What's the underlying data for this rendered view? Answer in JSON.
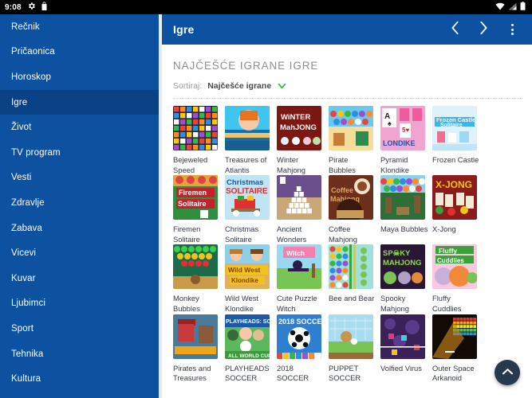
{
  "statusbar": {
    "time": "9:08",
    "icons_left": [
      "gear-icon",
      "shopping-bag-icon"
    ],
    "icons_right": [
      "wifi-icon",
      "signal-icon",
      "battery-icon"
    ]
  },
  "sidebar": {
    "background_color": "#0d52a0",
    "active_color": "#0a4184",
    "items": [
      {
        "label": "Rečnik",
        "active": false
      },
      {
        "label": "Pričaonica",
        "active": false
      },
      {
        "label": "Horoskop",
        "active": false
      },
      {
        "label": "Igre",
        "active": true
      },
      {
        "label": "Život",
        "active": false
      },
      {
        "label": "TV program",
        "active": false
      },
      {
        "label": "Vesti",
        "active": false
      },
      {
        "label": "Zdravlje",
        "active": false
      },
      {
        "label": "Zabava",
        "active": false
      },
      {
        "label": "Vicevi",
        "active": false
      },
      {
        "label": "Kuvar",
        "active": false
      },
      {
        "label": "Ljubimci",
        "active": false
      },
      {
        "label": "Sport",
        "active": false
      },
      {
        "label": "Tehnika",
        "active": false
      },
      {
        "label": "Kultura",
        "active": false
      }
    ]
  },
  "appbar": {
    "title": "Igre",
    "back_icon": "chevron-left-icon",
    "forward_icon": "chevron-right-icon",
    "overflow_icon": "more-vertical-icon"
  },
  "main": {
    "section_title": "NAJČEŠĆE IGRANE IGRE",
    "sort_label": "Sortiraj:",
    "sort_value": "Najčešće igrane",
    "sort_caret_icon": "chevron-down-icon",
    "sort_caret_color": "#39b54a",
    "games": [
      {
        "title": "Bejeweled Speed",
        "thumb": "bejeweled"
      },
      {
        "title": "Treasures of Atlantis",
        "thumb": "atlantis"
      },
      {
        "title": "Winter Mahjong",
        "thumb": "winter-mahjong"
      },
      {
        "title": "Pirate Bubbles",
        "thumb": "pirate-bubbles"
      },
      {
        "title": "Pyramid Klondike",
        "thumb": "pyramid-klondike"
      },
      {
        "title": "Frozen Castle",
        "thumb": "frozen-castle"
      },
      {
        "title": "Firemen Solitaire",
        "thumb": "firemen-solitaire"
      },
      {
        "title": "Christmas Solitaire",
        "thumb": "christmas-solitaire"
      },
      {
        "title": "Ancient Wonders",
        "thumb": "ancient-wonders"
      },
      {
        "title": "Coffee Mahjong",
        "thumb": "coffee-mahjong"
      },
      {
        "title": "Maya Bubbles",
        "thumb": "maya-bubbles"
      },
      {
        "title": "X-Jong",
        "thumb": "x-jong"
      },
      {
        "title": "Monkey Bubbles",
        "thumb": "monkey-bubbles"
      },
      {
        "title": "Wild West Klondike",
        "thumb": "wild-west"
      },
      {
        "title": "Cute Puzzle Witch",
        "thumb": "cute-witch"
      },
      {
        "title": "Bee and Bear",
        "thumb": "bee-bear"
      },
      {
        "title": "Spooky Mahjong",
        "thumb": "spooky-mahjong"
      },
      {
        "title": "Fluffy Cuddlies",
        "thumb": "fluffy-cuddlies"
      },
      {
        "title": "Pirates and Treasures",
        "thumb": "pirates-treasures"
      },
      {
        "title": "PLAYHEADS SOCCER",
        "thumb": "playheads-soccer"
      },
      {
        "title": "2018 SOCCER",
        "thumb": "soccer-2018"
      },
      {
        "title": "PUPPET SOCCER",
        "thumb": "puppet-soccer"
      },
      {
        "title": "Volfied Virus",
        "thumb": "volfied-virus"
      },
      {
        "title": "Outer Space Arkanoid",
        "thumb": "outer-space"
      }
    ]
  },
  "fab": {
    "icon": "chevron-up-icon",
    "color": "#27394f"
  }
}
